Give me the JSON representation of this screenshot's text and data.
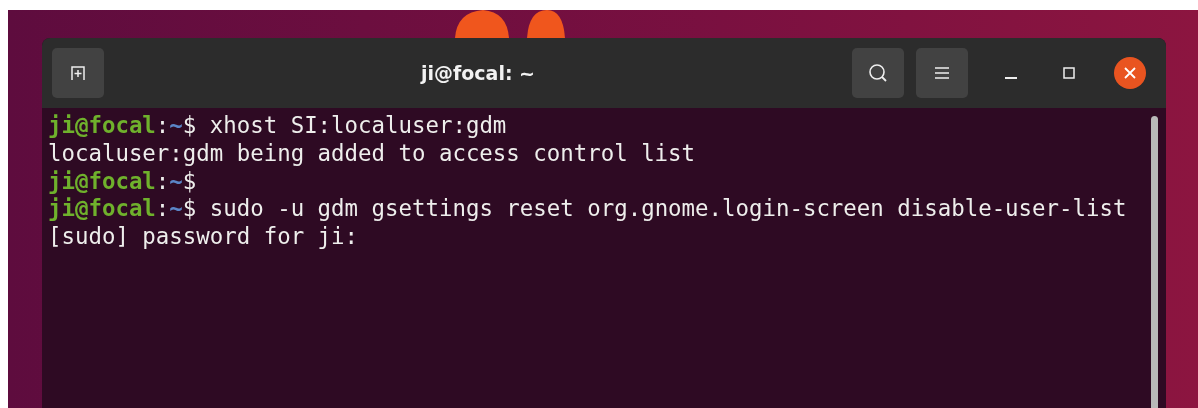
{
  "window": {
    "title": "ji@focal: ~"
  },
  "terminal": {
    "lines": [
      {
        "kind": "prompt",
        "user_host": "ji@focal",
        "separator": ":",
        "path": "~",
        "symbol": "$",
        "command": " xhost SI:localuser:gdm"
      },
      {
        "kind": "output",
        "text": "localuser:gdm being added to access control list"
      },
      {
        "kind": "prompt",
        "user_host": "ji@focal",
        "separator": ":",
        "path": "~",
        "symbol": "$"
      },
      {
        "kind": "prompt",
        "user_host": "ji@focal",
        "separator": ":",
        "path": "~",
        "symbol": "$",
        "command": " sudo -u gdm gsettings reset org.gnome.login-screen disable-user-list"
      },
      {
        "kind": "output",
        "text": "[sudo] password for ji:"
      }
    ]
  }
}
